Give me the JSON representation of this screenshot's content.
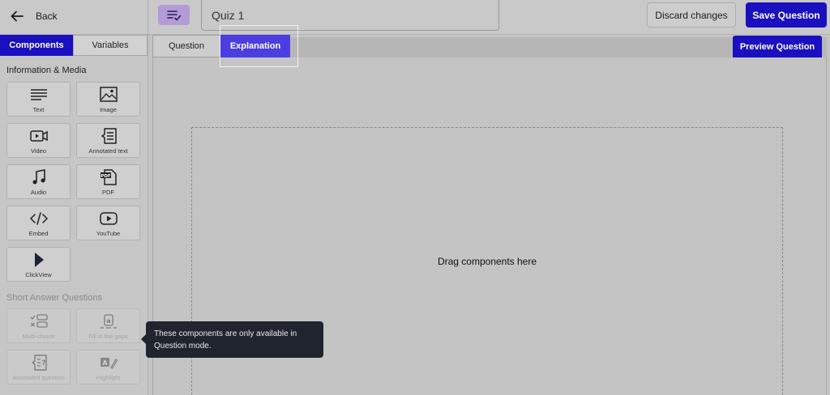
{
  "header": {
    "back_label": "Back",
    "title_value": "Quiz 1",
    "discard_label": "Discard changes",
    "save_label": "Save Question"
  },
  "sidebar": {
    "tabs": [
      {
        "label": "Components",
        "active": true
      },
      {
        "label": "Variables",
        "active": false
      }
    ],
    "sections": [
      {
        "title": "Information & Media",
        "items": [
          {
            "label": "Text",
            "icon": "text-icon"
          },
          {
            "label": "Image",
            "icon": "image-icon"
          },
          {
            "label": "Video",
            "icon": "video-icon"
          },
          {
            "label": "Annotated text",
            "icon": "annotated-text-icon"
          },
          {
            "label": "Audio",
            "icon": "audio-icon"
          },
          {
            "label": "PDF",
            "icon": "pdf-icon"
          },
          {
            "label": "Embed",
            "icon": "embed-icon"
          },
          {
            "label": "YouTube",
            "icon": "youtube-icon"
          },
          {
            "label": "ClickView",
            "icon": "clickview-icon"
          }
        ]
      },
      {
        "title": "Short Answer Questions",
        "items": [
          {
            "label": "Multi-choice",
            "icon": "multi-choice-icon"
          },
          {
            "label": "Fill in the gaps",
            "icon": "fill-in-gaps-icon"
          },
          {
            "label": "Annotated question",
            "icon": "annotated-question-icon"
          },
          {
            "label": "Highlight",
            "icon": "highlight-icon"
          }
        ]
      }
    ]
  },
  "main": {
    "tabs": [
      {
        "label": "Question",
        "active": false
      },
      {
        "label": "Explanation",
        "active": true
      }
    ],
    "preview_label": "Preview Question",
    "dropzone_text": "Drag components here"
  },
  "tooltip": {
    "text": "These components are only available in Question mode."
  },
  "colors": {
    "primary": "#1a10c0",
    "active_tab": "#4b3de0",
    "question_icon_bg": "#b39bd6",
    "tooltip_bg": "#20242e"
  }
}
